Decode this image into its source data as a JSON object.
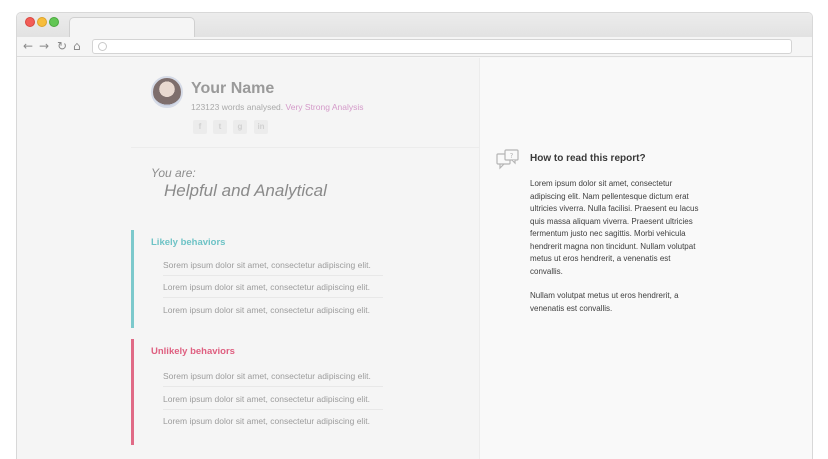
{
  "profile": {
    "name": "Your Name",
    "words_analysed": "123123 words analysed.",
    "strength": "Very Strong Analysis",
    "social_icons": [
      "facebook-icon",
      "twitter-icon",
      "google-plus-icon",
      "linkedin-icon"
    ]
  },
  "summary": {
    "you_are": "You are:",
    "headline": "Helpful and Analytical"
  },
  "likely": {
    "title": "Likely behaviors",
    "color": "#7cc9cc",
    "items": [
      "Sorem ipsum dolor sit amet, consectetur adipiscing elit.",
      "Lorem ipsum dolor sit amet, consectetur adipiscing elit.",
      "Lorem ipsum dolor sit amet, consectetur adipiscing elit."
    ]
  },
  "unlikely": {
    "title": "Unlikely behaviors",
    "color": "#e06a86",
    "items": [
      "Sorem ipsum dolor sit amet, consectetur adipiscing elit.",
      "Lorem ipsum dolor sit amet, consectetur adipiscing elit.",
      "Lorem ipsum dolor sit amet, consectetur adipiscing elit."
    ]
  },
  "help": {
    "title": "How to read this report?",
    "paragraphs": [
      "Lorem ipsum dolor sit amet, consectetur adipiscing elit. Nam pellentesque dictum erat ultricies viverra. Nulla facilisi. Praesent eu lacus quis massa aliquam viverra. Praesent ultricies fermentum justo nec sagittis. Morbi vehicula hendrerit magna non tincidunt. Nullam volutpat metus ut eros hendrerit, a venenatis est convallis.",
      "Nullam volutpat metus ut eros hendrerit, a venenatis est convallis."
    ]
  }
}
